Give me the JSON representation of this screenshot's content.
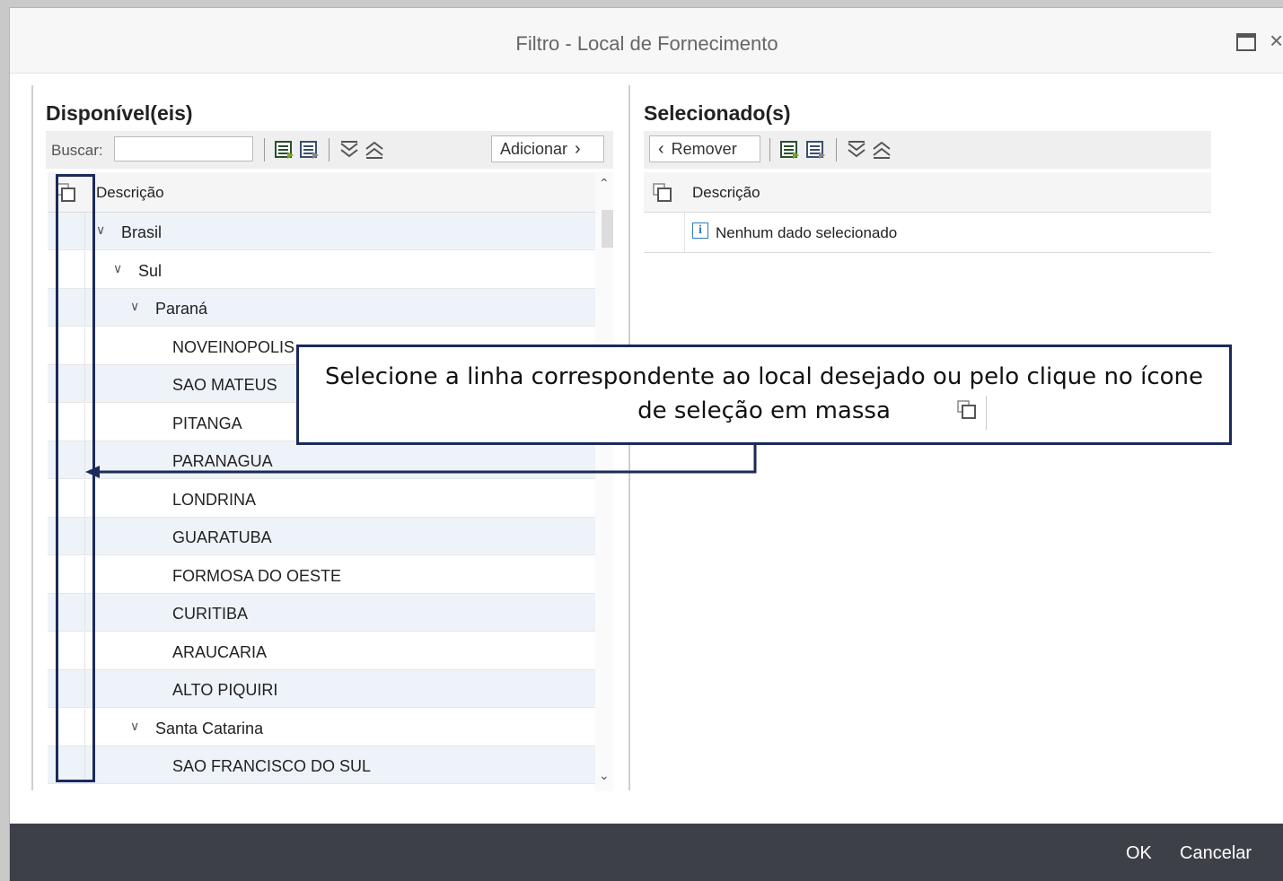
{
  "dialog": {
    "title": "Filtro - Local de Fornecimento",
    "close_glyph": "×"
  },
  "available": {
    "title": "Disponível(eis)",
    "search_label": "Buscar:",
    "search_value": "",
    "add_button": "Adicionar",
    "column_header": "Descrição",
    "rows": [
      {
        "label": "Brasil",
        "level": 0,
        "expanded": true
      },
      {
        "label": "Sul",
        "level": 1,
        "expanded": true
      },
      {
        "label": "Paraná",
        "level": 2,
        "expanded": true
      },
      {
        "label": "NOVEINOPOLIS",
        "level": 3
      },
      {
        "label": "SAO MATEUS",
        "level": 3
      },
      {
        "label": "PITANGA",
        "level": 3
      },
      {
        "label": "PARANAGUA",
        "level": 3
      },
      {
        "label": "LONDRINA",
        "level": 3
      },
      {
        "label": "GUARATUBA",
        "level": 3
      },
      {
        "label": "FORMOSA DO OESTE",
        "level": 3
      },
      {
        "label": "CURITIBA",
        "level": 3
      },
      {
        "label": "ARAUCARIA",
        "level": 3
      },
      {
        "label": "ALTO PIQUIRI",
        "level": 3
      },
      {
        "label": "Santa Catarina",
        "level": 2,
        "expanded": true
      },
      {
        "label": "SAO FRANCISCO DO SUL",
        "level": 3
      }
    ]
  },
  "selected": {
    "title": "Selecionado(s)",
    "remove_button": "Remover",
    "column_header": "Descrição",
    "empty_message": "Nenhum dado selecionado"
  },
  "footer": {
    "ok": "OK",
    "cancel": "Cancelar"
  },
  "callout": {
    "line1": "Selecione a linha correspondente ao local desejado ou pelo clique no ícone",
    "line2": "de seleção em massa"
  },
  "colors": {
    "footer_bg": "#3d4147",
    "row_alt": "#eef3f9",
    "annotation": "#1b2a5a"
  },
  "icons": [
    "maximize-icon",
    "close-icon",
    "select-all-icon",
    "deselect-all-icon",
    "expand-all-icon",
    "collapse-all-icon",
    "mass-select-icon",
    "info-icon",
    "chevron-down-icon",
    "chevron-left-icon",
    "chevron-right-icon"
  ]
}
